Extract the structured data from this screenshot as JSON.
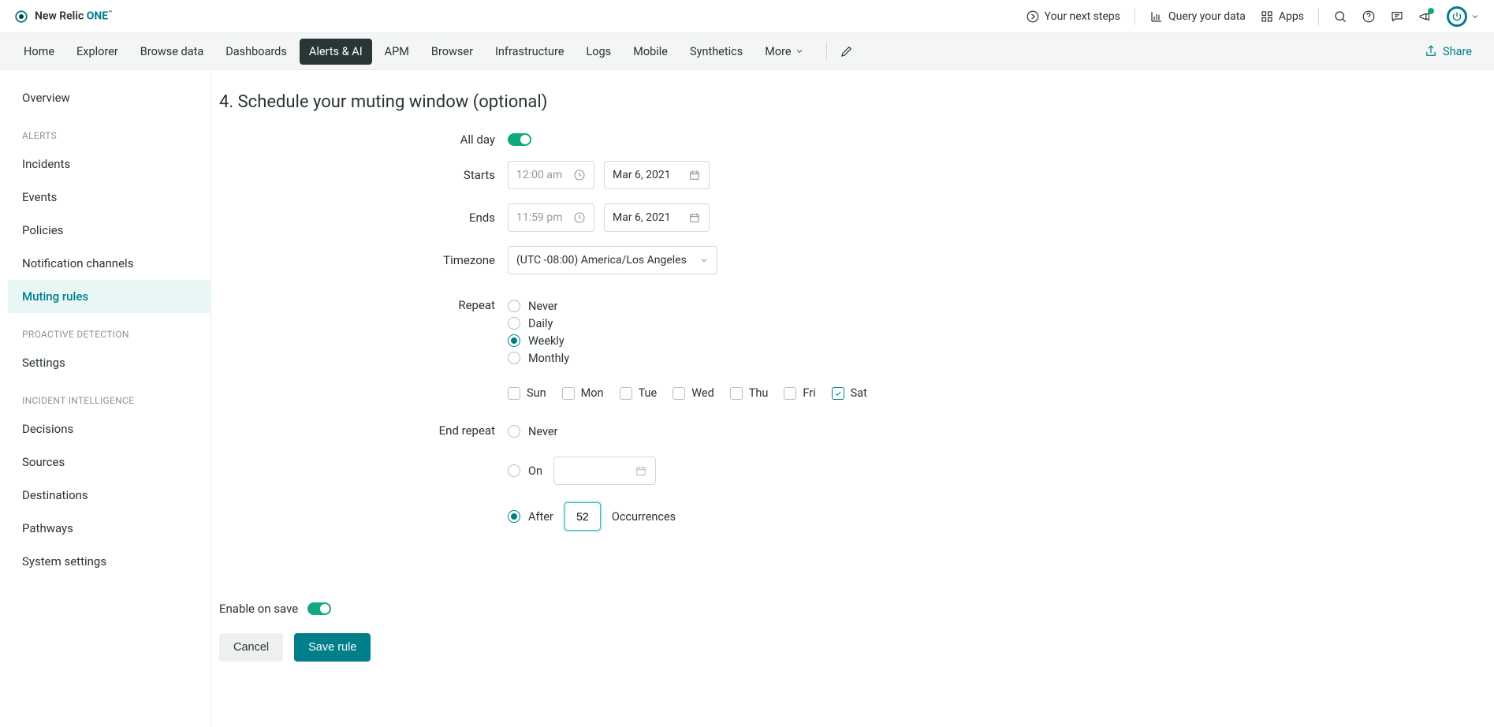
{
  "brand": {
    "name": "New Relic",
    "suffix": "ONE",
    "tm": "™"
  },
  "topbar": {
    "next_steps": "Your next steps",
    "query_data": "Query your data",
    "apps": "Apps"
  },
  "mainnav": {
    "items": [
      "Home",
      "Explorer",
      "Browse data",
      "Dashboards",
      "Alerts & AI",
      "APM",
      "Browser",
      "Infrastructure",
      "Logs",
      "Mobile",
      "Synthetics",
      "More"
    ],
    "active_index": 4,
    "share": "Share"
  },
  "sidebar": {
    "overview": "Overview",
    "groups": [
      {
        "title": "ALERTS",
        "items": [
          "Incidents",
          "Events",
          "Policies",
          "Notification channels",
          "Muting rules"
        ],
        "active_index": 4
      },
      {
        "title": "PROACTIVE DETECTION",
        "items": [
          "Settings"
        ],
        "active_index": -1
      },
      {
        "title": "INCIDENT INTELLIGENCE",
        "items": [
          "Decisions",
          "Sources",
          "Destinations",
          "Pathways",
          "System settings"
        ],
        "active_index": -1
      }
    ]
  },
  "form": {
    "title": "4. Schedule your muting window (optional)",
    "all_day_label": "All day",
    "all_day_on": true,
    "starts_label": "Starts",
    "starts_time": "12:00 am",
    "starts_date": "Mar 6, 2021",
    "ends_label": "Ends",
    "ends_time": "11:59 pm",
    "ends_date": "Mar 6, 2021",
    "timezone_label": "Timezone",
    "timezone_value": "(UTC -08:00) America/Los Angeles",
    "repeat_label": "Repeat",
    "repeat_options": [
      "Never",
      "Daily",
      "Weekly",
      "Monthly"
    ],
    "repeat_selected": "Weekly",
    "days": [
      "Sun",
      "Mon",
      "Tue",
      "Wed",
      "Thu",
      "Fri",
      "Sat"
    ],
    "days_checked": [
      "Sat"
    ],
    "end_repeat_label": "End repeat",
    "end_repeat_options": {
      "never": "Never",
      "on": "On",
      "after": "After"
    },
    "end_repeat_selected": "after",
    "occurrences_value": "52",
    "occurrences_suffix": "Occurrences",
    "enable_on_save": "Enable on save",
    "enable_on_save_on": true,
    "cancel": "Cancel",
    "save": "Save rule"
  }
}
